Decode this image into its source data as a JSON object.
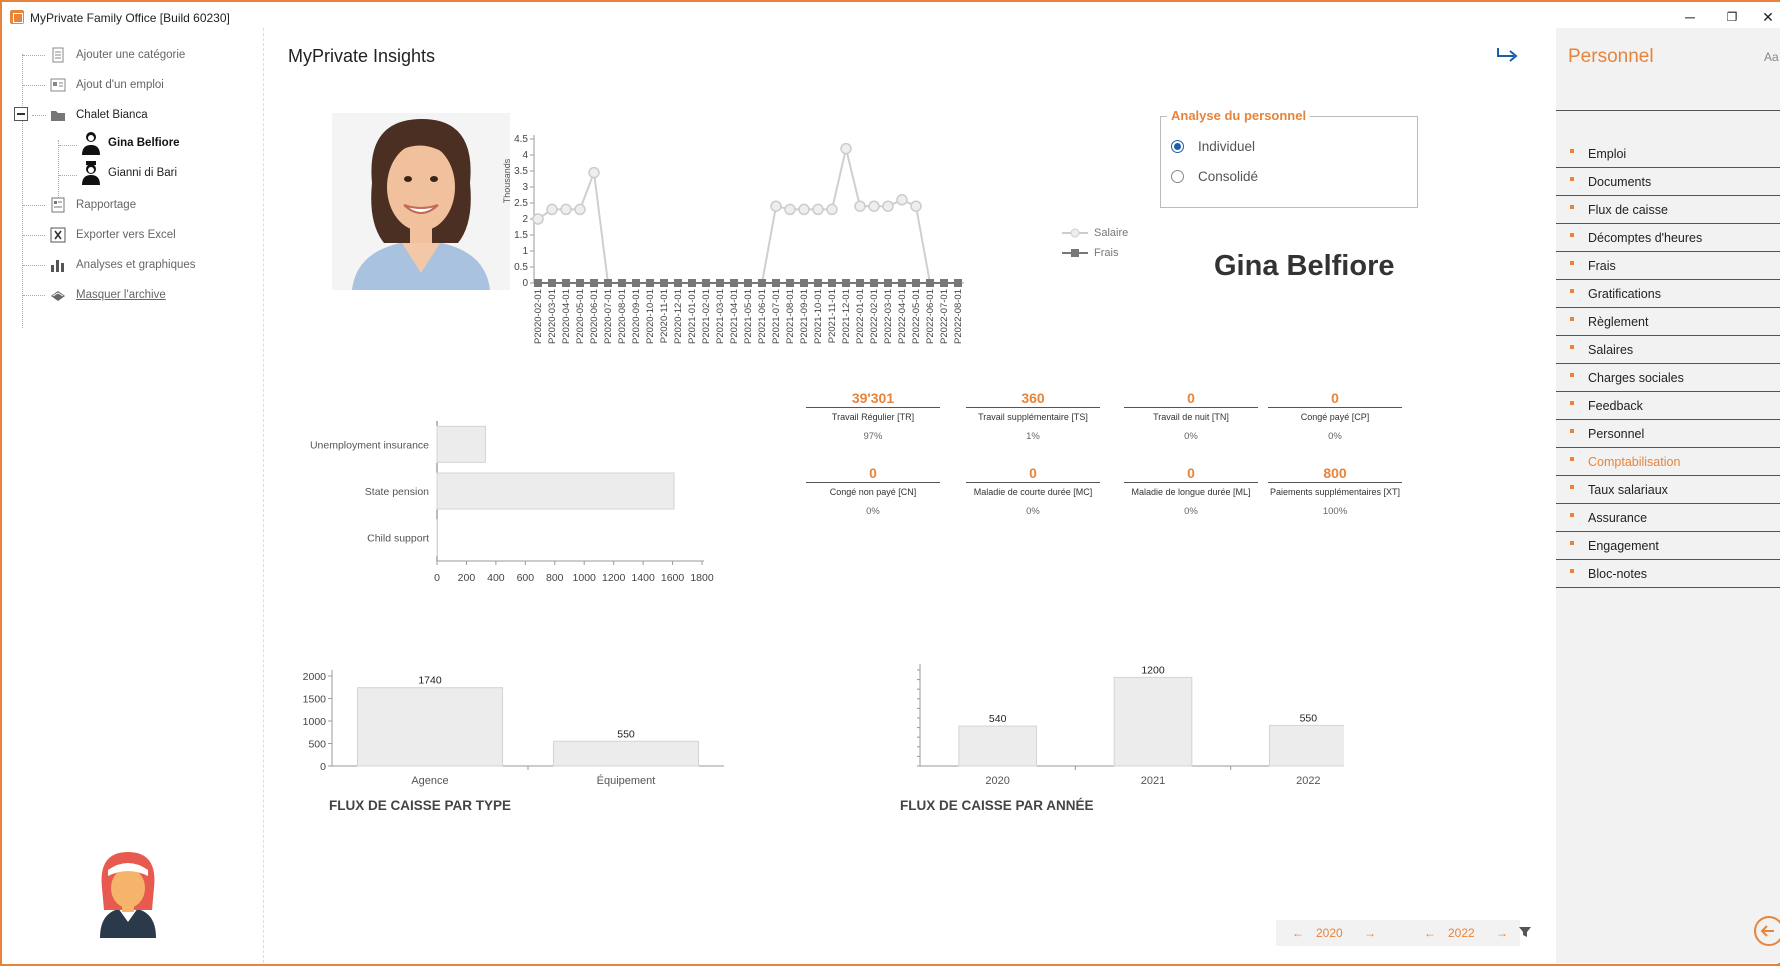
{
  "window": {
    "title": "MyPrivate Family Office [Build 60230]",
    "minimize": "─",
    "restore": "❐",
    "close": "✕"
  },
  "tree": {
    "items": [
      {
        "label": "Ajouter une catégorie",
        "icon": "document-icon"
      },
      {
        "label": "Ajout d'un emploi",
        "icon": "job-icon"
      },
      {
        "label": "Chalet Bianca",
        "icon": "folder-icon"
      },
      {
        "label": "Gina Belfiore",
        "icon": "person-female-icon"
      },
      {
        "label": "Gianni di Bari",
        "icon": "person-male-icon"
      },
      {
        "label": "Rapportage",
        "icon": "report-icon"
      },
      {
        "label": "Exporter vers Excel",
        "icon": "excel-icon"
      },
      {
        "label": "Analyses et graphiques",
        "icon": "bar-chart-icon"
      },
      {
        "label": "Masquer l'archive",
        "icon": "archive-icon"
      }
    ]
  },
  "main": {
    "title": "MyPrivate Insights",
    "person_name": "Gina Belfiore",
    "analyse": {
      "legend": "Analyse du personnel",
      "options": [
        "Individuel",
        "Consolidé"
      ],
      "selected": "Individuel"
    },
    "kpis": [
      {
        "value": "39'301",
        "label": "Travail Régulier [TR]",
        "pct": "97%"
      },
      {
        "value": "360",
        "label": "Travail supplémentaire [TS]",
        "pct": "1%"
      },
      {
        "value": "0",
        "label": "Travail de nuit [TN]",
        "pct": "0%"
      },
      {
        "value": "0",
        "label": "Congé payé [CP]",
        "pct": "0%"
      },
      {
        "value": "0",
        "label": "Congé non payé [CN]",
        "pct": "0%"
      },
      {
        "value": "0",
        "label": "Maladie de courte durée [MC]",
        "pct": "0%"
      },
      {
        "value": "0",
        "label": "Maladie de longue durée [ML]",
        "pct": "0%"
      },
      {
        "value": "800",
        "label": "Paiements supplémentaires [XT]",
        "pct": "100%"
      }
    ],
    "section_titles": {
      "by_type": "FLUX DE CAISSE PAR TYPE",
      "by_year": "FLUX DE CAISSE PAR ANNÉE"
    },
    "nav": {
      "prev": "←",
      "next": "→",
      "from_year": "2020",
      "to_year": "2022",
      "filter_icon": "filter-icon"
    }
  },
  "right_panel": {
    "title": "Personnel",
    "font_toggle": "Aa",
    "items": [
      "Emploi",
      "Documents",
      "Flux de caisse",
      "Décomptes d'heures",
      "Frais",
      "Gratifications",
      "Règlement",
      "Salaires",
      "Charges sociales",
      "Feedback",
      "Personnel",
      "Comptabilisation",
      "Taux salariaux",
      "Assurance",
      "Engagement",
      "Bloc-notes"
    ],
    "active": "Comptabilisation",
    "back_icon": "back-arrow-icon"
  },
  "accent_color": "#e8833a",
  "chart_data": [
    {
      "type": "line",
      "ylabel": "Thousands",
      "ylim": [
        0,
        4.5
      ],
      "yticks": [
        "0",
        "0.5",
        "1",
        "1.5",
        "2",
        "2.5",
        "3",
        "3.5",
        "4",
        "4.5"
      ],
      "x": [
        "P2020-02-01",
        "P2020-03-01",
        "P2020-04-01",
        "P2020-05-01",
        "P2020-06-01",
        "P2020-07-01",
        "P2020-08-01",
        "P2020-09-01",
        "P2020-10-01",
        "P2020-11-01",
        "P2020-12-01",
        "P2021-01-01",
        "P2021-02-01",
        "P2021-03-01",
        "P2021-04-01",
        "P2021-05-01",
        "P2021-06-01",
        "P2021-07-01",
        "P2021-08-01",
        "P2021-09-01",
        "P2021-10-01",
        "P2021-11-01",
        "P2021-12-01",
        "P2022-01-01",
        "P2022-02-01",
        "P2022-03-01",
        "P2022-04-01",
        "P2022-05-01",
        "P2022-06-01",
        "P2022-07-01",
        "P2022-08-01"
      ],
      "series": [
        {
          "name": "Salaire",
          "values": [
            2.0,
            2.3,
            2.3,
            2.3,
            3.45,
            0,
            0,
            0,
            0,
            0,
            0,
            0,
            0,
            0,
            0,
            0,
            0,
            2.4,
            2.3,
            2.3,
            2.3,
            2.3,
            4.2,
            2.4,
            2.4,
            2.4,
            2.6,
            2.4,
            0,
            0,
            0
          ]
        },
        {
          "name": "Frais",
          "values": [
            0,
            0,
            0,
            0,
            0,
            0,
            0,
            0,
            0,
            0,
            0,
            0,
            0,
            0,
            0,
            0,
            0,
            0,
            0,
            0,
            0,
            0,
            0,
            0,
            0,
            0,
            0,
            0,
            0,
            0,
            0
          ]
        }
      ]
    },
    {
      "type": "bar",
      "orientation": "horizontal",
      "categories": [
        "Unemployment insurance",
        "State pension",
        "Child support"
      ],
      "values": [
        330,
        1610,
        0
      ],
      "xlim": [
        0,
        1800
      ],
      "xticks": [
        "0",
        "200",
        "400",
        "600",
        "800",
        "1000",
        "1200",
        "1400",
        "1600",
        "1800"
      ]
    },
    {
      "type": "bar",
      "title": "FLUX DE CAISSE PAR TYPE",
      "categories": [
        "Agence",
        "Équipement"
      ],
      "values": [
        1740,
        550
      ],
      "ylim": [
        0,
        2000
      ],
      "yticks": [
        "0",
        "500",
        "1000",
        "1500",
        "2000"
      ]
    },
    {
      "type": "bar",
      "title": "FLUX DE CAISSE PAR ANNÉE",
      "categories": [
        "2020",
        "2021",
        "2022"
      ],
      "values": [
        540,
        1200,
        550
      ],
      "ylim": [
        0,
        1300
      ]
    }
  ]
}
